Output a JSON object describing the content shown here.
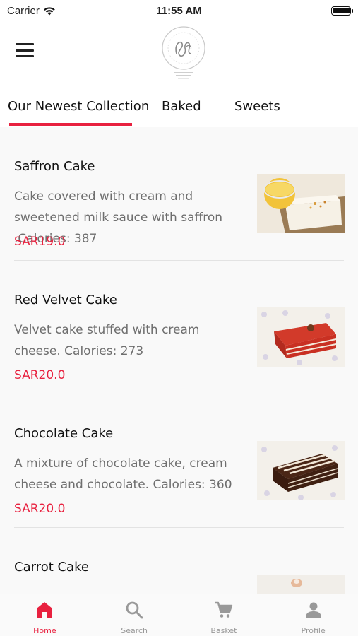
{
  "status_bar": {
    "carrier": "Carrier",
    "time": "11:55 AM"
  },
  "tabs": [
    {
      "label": "Our Newest Collection",
      "active": true
    },
    {
      "label": "Baked",
      "active": false
    },
    {
      "label": "Sweets",
      "active": false
    }
  ],
  "products": [
    {
      "name": "Saffron Cake",
      "description": "Cake covered with cream and sweetened milk sauce with saffron .Calories: 387",
      "price": "SAR19.0",
      "image_icon": "saffron-cake-photo"
    },
    {
      "name": "Red Velvet Cake",
      "description": "Velvet cake stuffed with cream cheese. Calories: 273",
      "price": "SAR20.0",
      "image_icon": "red-velvet-cake-photo"
    },
    {
      "name": "Chocolate Cake",
      "description": "A mixture of chocolate cake, cream cheese and chocolate. Calories: 360",
      "price": "SAR20.0",
      "image_icon": "chocolate-cake-photo"
    },
    {
      "name": "Carrot Cake",
      "image_icon": "carrot-cake-photo"
    }
  ],
  "bottom_nav": [
    {
      "label": "Home",
      "icon": "home-icon",
      "active": true
    },
    {
      "label": "Search",
      "icon": "search-icon",
      "active": false
    },
    {
      "label": "Basket",
      "icon": "cart-icon",
      "active": false
    },
    {
      "label": "Profile",
      "icon": "profile-icon",
      "active": false
    }
  ],
  "colors": {
    "accent": "#e8213f",
    "muted_text": "#6e6e6e",
    "inactive_nav": "#999999"
  }
}
